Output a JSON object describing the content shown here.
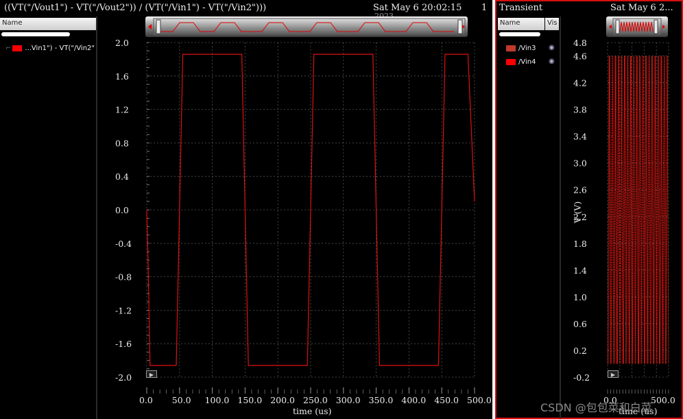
{
  "colors": {
    "trace": "#e01010",
    "vin3": "#c0392b",
    "vin4": "#ff0000",
    "grid": "#555555",
    "bg": "#000000"
  },
  "left": {
    "title": "((VT(\"/Vout1\") - VT(\"/Vout2\")) / (VT(\"/Vin1\") - VT(\"/Vin2\")))",
    "date": "Sat May 6 20:02:15",
    "date_overflow": "2023",
    "pane_number": "1",
    "name_header": "Name",
    "legend_label": "...Vin1\") - VT(\"/Vin2\"",
    "xlabel": "time (us)",
    "play_icon": "play-icon"
  },
  "right": {
    "title": "Transient",
    "date": "Sat May 6 2...",
    "name_header": "Name",
    "vis_header": "Vis",
    "legend": [
      {
        "label": "/Vin3",
        "icon": "eye-icon"
      },
      {
        "label": "/Vin4",
        "icon": "eye-icon"
      }
    ],
    "ylabel": "V (V)",
    "xlabel": "time (us)",
    "play_icon": "play-icon"
  },
  "watermark": "CSDN @包包菜和白菜",
  "chart_data": [
    {
      "type": "line",
      "title": "((VT(\"/Vout1\") - VT(\"/Vout2\")) / (VT(\"/Vin1\") - VT(\"/Vin2\")))",
      "xlabel": "time (us)",
      "ylabel": "",
      "xlim": [
        0,
        500
      ],
      "ylim": [
        -2.0,
        2.0
      ],
      "grid": true,
      "x_ticks": [
        "0.0",
        "50.0",
        "100.0",
        "150.0",
        "200.0",
        "250.0",
        "300.0",
        "350.0",
        "400.0",
        "450.0",
        "500.0"
      ],
      "y_ticks": [
        "2.0",
        "1.6",
        "1.2",
        "0.8",
        "0.4",
        "0.0",
        "-0.4",
        "-0.8",
        "-1.2",
        "-1.6",
        "-2.0"
      ],
      "series": [
        {
          "name": "...Vin1\") - VT(\"/Vin2\"",
          "color": "#e01010",
          "x": [
            0,
            2,
            5,
            10,
            45,
            55,
            90,
            95,
            145,
            155,
            190,
            195,
            245,
            255,
            290,
            295,
            345,
            355,
            390,
            395,
            445,
            455,
            490,
            500
          ],
          "y": [
            0,
            -0.6,
            -1.86,
            -1.86,
            -1.86,
            1.86,
            1.86,
            1.86,
            1.86,
            -1.86,
            -1.86,
            -1.86,
            -1.86,
            1.86,
            1.86,
            1.86,
            1.86,
            -1.86,
            -1.86,
            -1.86,
            -1.86,
            1.86,
            1.86,
            0.1
          ]
        }
      ]
    },
    {
      "type": "line",
      "title": "Transient",
      "xlabel": "time (us)",
      "ylabel": "V (V)",
      "xlim": [
        0,
        500
      ],
      "ylim": [
        -0.2,
        4.8
      ],
      "grid": true,
      "x_ticks": [
        "0.0",
        "500.0"
      ],
      "y_ticks": [
        "4.8",
        "4.6",
        "4.2",
        "3.8",
        "3.4",
        "3.0",
        "2.6",
        "2.2",
        "1.8",
        "1.4",
        "1.0",
        "0.6",
        "0.2",
        "-0.2"
      ],
      "series": [
        {
          "name": "/Vin3",
          "color": "#c0392b",
          "min": 0.0,
          "max": 4.6,
          "cycles": 20
        },
        {
          "name": "/Vin4",
          "color": "#ff0000",
          "min": 0.0,
          "max": 4.6,
          "cycles": 20,
          "phase": 0.5
        }
      ]
    }
  ]
}
